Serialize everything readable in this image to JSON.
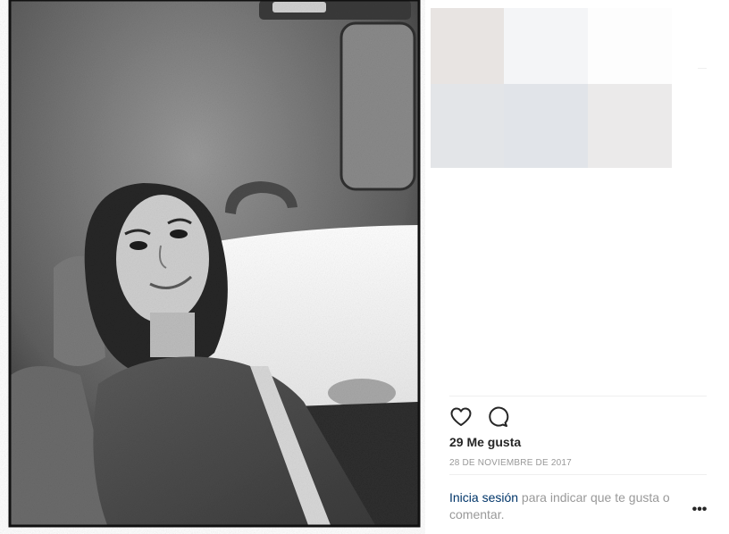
{
  "post": {
    "likes_text": "29 Me gusta",
    "date_text": "28 DE NOVIEMBRE DE 2017",
    "login_link": "Inicia sesión",
    "login_rest": " para indicar que te gusta o comentar.",
    "more_label": "•••"
  },
  "icons": {
    "like": "heart-outline-icon",
    "comment": "comment-bubble-icon",
    "more": "more-options-icon"
  },
  "colors": {
    "link": "#003569",
    "muted": "#999999",
    "text": "#262626"
  }
}
